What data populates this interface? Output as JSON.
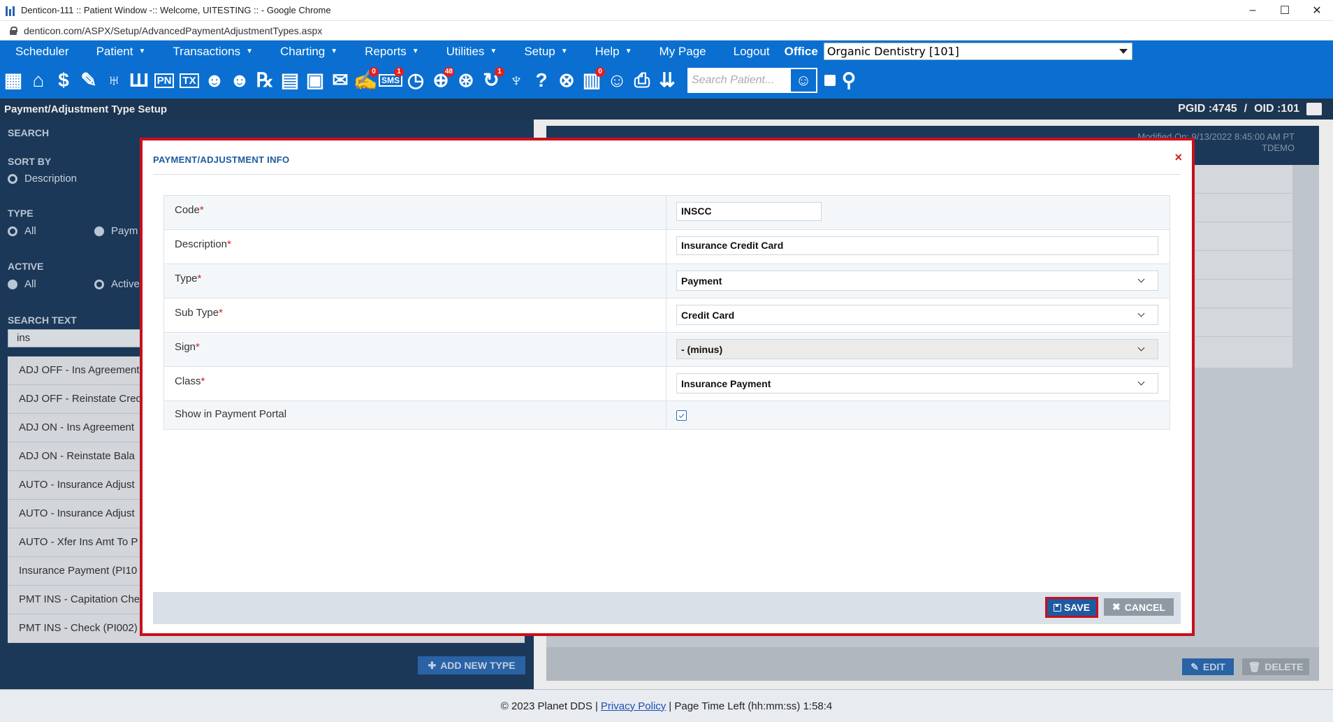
{
  "window": {
    "title": "Denticon-111 :: Patient Window -:: Welcome, UITESTING :: - Google Chrome",
    "url": "denticon.com/ASPX/Setup/AdvancedPaymentAdjustmentTypes.aspx",
    "controls": [
      "–",
      "☐",
      "✕"
    ]
  },
  "menu": {
    "items": [
      {
        "label": "Scheduler",
        "caret": false
      },
      {
        "label": "Patient",
        "caret": true
      },
      {
        "label": "Transactions",
        "caret": true
      },
      {
        "label": "Charting",
        "caret": true
      },
      {
        "label": "Reports",
        "caret": true
      },
      {
        "label": "Utilities",
        "caret": true
      },
      {
        "label": "Setup",
        "caret": true
      },
      {
        "label": "Help",
        "caret": true
      },
      {
        "label": "My Page",
        "caret": false
      },
      {
        "label": "Logout",
        "caret": false
      }
    ],
    "office_label": "Office",
    "office_value": "Organic Dentistry [101]"
  },
  "toolbar": {
    "badges": {
      "messages": "0",
      "sms": "1",
      "online": "48",
      "recall": "1",
      "forms": "0"
    },
    "search_placeholder": "Search Patient..."
  },
  "page": {
    "title": "Payment/Adjustment Type Setup",
    "pgid": "PGID :4745",
    "separator": "/",
    "oid": "OID :101"
  },
  "left": {
    "search_header": "SEARCH",
    "sort_by": "SORT BY",
    "sort_option": "Description",
    "type": "TYPE",
    "type_all": "All",
    "type_payment": "Paym",
    "active": "ACTIVE",
    "active_all": "All",
    "active_active": "Active",
    "search_text_label": "SEARCH TEXT",
    "search_text_value": "ins",
    "list": [
      "ADJ OFF - Ins Agreement",
      "ADJ OFF - Reinstate Cred",
      "ADJ ON - Ins Agreement",
      "ADJ ON - Reinstate Bala",
      "AUTO - Insurance Adjust",
      "AUTO - Insurance Adjust",
      "AUTO - Xfer Ins Amt To P",
      "Insurance Payment (PI10",
      "PMT INS - Capitation Che",
      "PMT INS - Check (PI002)"
    ],
    "add_button": "ADD NEW TYPE"
  },
  "right": {
    "modified_line1": "Modified On: 9/13/2022 8:45:00 AM PT",
    "modified_line2": "TDEMO",
    "edit": "EDIT",
    "delete": "DELETE"
  },
  "modal": {
    "title": "PAYMENT/ADJUSTMENT INFO",
    "close": "×",
    "fields": {
      "code_label": "Code",
      "code_value": "INSCC",
      "description_label": "Description",
      "description_value": "Insurance Credit Card",
      "type_label": "Type",
      "type_value": "Payment",
      "subtype_label": "Sub Type",
      "subtype_value": "Credit Card",
      "sign_label": "Sign",
      "sign_value": "- (minus)",
      "class_label": "Class",
      "class_value": "Insurance Payment",
      "portal_label": "Show in Payment Portal",
      "portal_checked": true,
      "required_mark": "*"
    },
    "save": "SAVE",
    "cancel": "CANCEL"
  },
  "footer": {
    "copyright": "© 2023 Planet DDS |",
    "privacy": "Privacy Policy",
    "time_left": "| Page Time Left (hh:mm:ss) 1:58:4"
  },
  "colors": {
    "menu_blue": "#0a6fd1",
    "header_navy": "#1e3a5b",
    "modal_border_red": "#c8101c",
    "save_blue": "#1e5aa0"
  }
}
